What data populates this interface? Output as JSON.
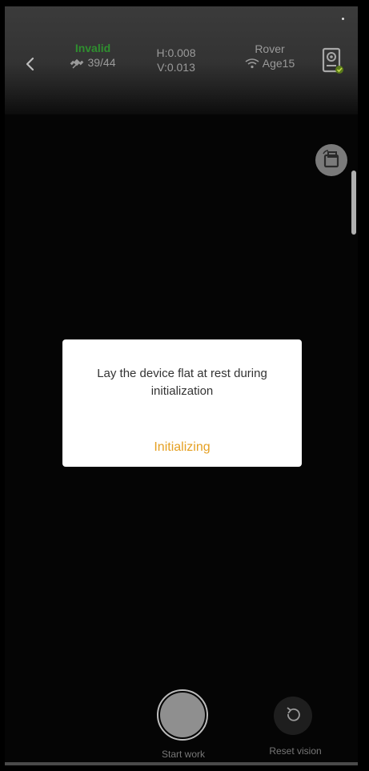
{
  "header": {
    "fix_status": "Invalid",
    "satellites": "39/44",
    "h_precision": "H:0.008",
    "v_precision": "V:0.013",
    "mode": "Rover",
    "age": "Age15"
  },
  "dialog": {
    "message": "Lay the device flat at rest during initialization",
    "status": "Initializing"
  },
  "footer": {
    "start_label": "Start work",
    "reset_label": "Reset vision"
  },
  "icons": [
    "back-icon",
    "satellite-icon",
    "wifi-icon",
    "device-icon",
    "rotate-icon",
    "reset-icon"
  ],
  "colors": {
    "fix_status": "#2f8f2f",
    "dialog_status": "#e5a022",
    "background": "#050505"
  }
}
